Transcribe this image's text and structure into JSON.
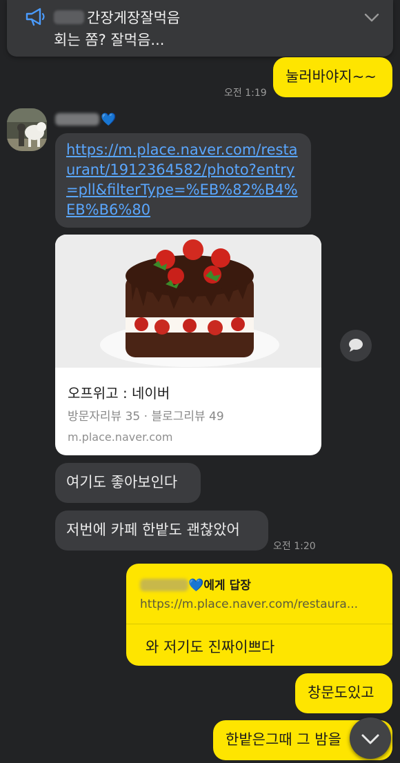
{
  "notice": {
    "line1": "간장게장잘먹음",
    "line2": "회는 쫌? 잘먹음..."
  },
  "messages": {
    "m1_text": "눌러바야지~~",
    "m1_time": "오전 1:19",
    "link_text": "https://m.place.naver.com/restaurant/1912364582/photo?entry=pll&filterType=%EB%82%B4%EB%B6%80",
    "m2_text": "여기도 좋아보인다",
    "m3_text": "저번에 카페 한밭도 괜찮았어",
    "m3_time": "오전 1:20",
    "m4_text": "창문도있고",
    "m5_text": "한밭은그때 그 밤을"
  },
  "link_preview": {
    "title": "오프위고 : 네이버",
    "subtitle": "방문자리뷰 35 · 블로그리뷰 49",
    "domain": "m.place.naver.com"
  },
  "reply": {
    "to_suffix": "에게 답장",
    "quoted": "https://m.place.naver.com/restaura...",
    "text": "와 저기도 진짜이쁘다"
  },
  "colors": {
    "background": "#222325",
    "my_bubble": "#fee500",
    "their_bubble": "#3b3c3f",
    "link": "#5aa7ff",
    "heart": "#3aa6ff"
  },
  "icons": {
    "notice": "megaphone-icon",
    "notice_toggle": "chevron-down-icon",
    "share": "speech-bubble-icon",
    "scroll": "chevron-down-icon"
  }
}
